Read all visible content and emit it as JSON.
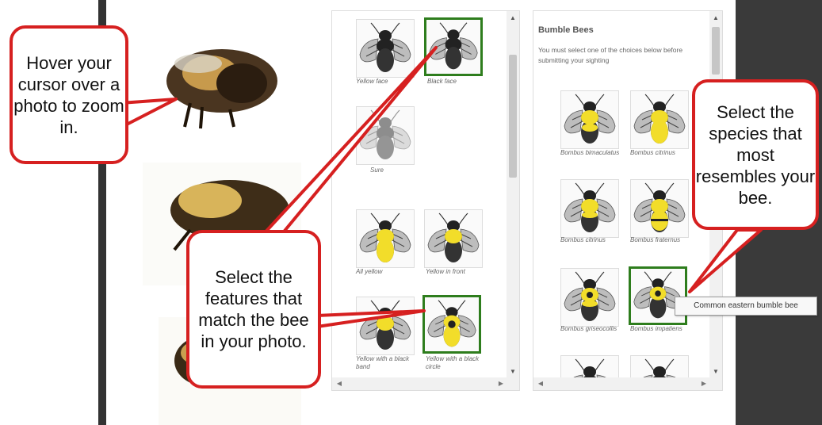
{
  "features_panel": {
    "tiles": [
      {
        "caption": "Yellow face"
      },
      {
        "caption": "Black face"
      },
      {
        "caption": "Sure"
      },
      {
        "caption": "All yellow"
      },
      {
        "caption": "Yellow in front"
      },
      {
        "caption": "Yellow with a black band"
      },
      {
        "caption": "Yellow with a black circle"
      }
    ]
  },
  "species_panel": {
    "title": "Bumble Bees",
    "note": "You must select one of the choices below before submitting your sighting",
    "tiles": [
      {
        "caption": "Bombus bimaculatus"
      },
      {
        "caption": "Bombus citrinus"
      },
      {
        "caption": "Bombus citrinus"
      },
      {
        "caption": "Bombus fraternus"
      },
      {
        "caption": "Bombus griseocollis"
      },
      {
        "caption": "Bombus impatiens"
      }
    ]
  },
  "tooltip": "Common eastern bumble bee",
  "callouts": {
    "hover": "Hover your cursor over a photo to zoom in.",
    "features": "Select the features that match the bee in your photo.",
    "species": "Select the species that most resembles your bee."
  },
  "colors": {
    "callout_border": "#d62020",
    "selected_border": "#2e7d1d",
    "bee_yellow": "#f2dd2a"
  }
}
